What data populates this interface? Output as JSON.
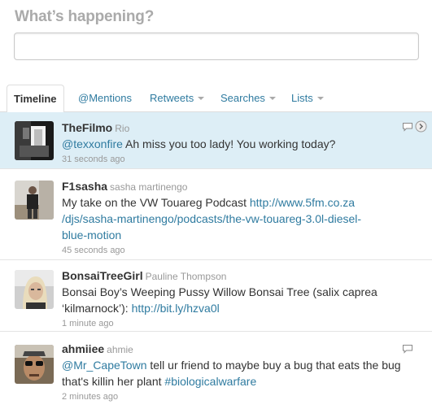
{
  "compose": {
    "title": "What’s happening?",
    "input_value": ""
  },
  "tabs": [
    {
      "label": "Timeline",
      "active": true
    },
    {
      "label": "@Mentions",
      "active": false
    },
    {
      "label": "Retweets",
      "active": false,
      "has_menu": true
    },
    {
      "label": "Searches",
      "active": false,
      "has_menu": true
    },
    {
      "label": "Lists",
      "active": false,
      "has_menu": true
    }
  ],
  "tweets": [
    {
      "screen_name": "TheFilmo",
      "full_name": "Rio",
      "mention": "@texxonfire",
      "text": " Ah miss you too lady! You working today?",
      "time": "31 seconds ago",
      "highlighted": true
    },
    {
      "screen_name": "F1sasha",
      "full_name": "sasha martinengo",
      "text_before": "My take on the VW Touareg Podcast ",
      "link": "http://www.5fm.co.za/djs/sasha-martinengo/podcasts/the-vw-touareg-3.0l-diesel-blue-motion",
      "link_line1": "http://www.5fm.co.za",
      "link_line2": "/djs/sasha-martinengo/podcasts/the-vw-touareg-3.0l-diesel-",
      "link_line3": "blue-motion",
      "time": "45 seconds ago"
    },
    {
      "screen_name": "BonsaiTreeGirl",
      "full_name": "Pauline Thompson",
      "text_line1": "Bonsai Boy’s Weeping Pussy Willow Bonsai Tree (salix caprea",
      "text_line2": "‘kilmarnock’): ",
      "link": "http://bit.ly/hzva0l",
      "time": "1 minute ago"
    },
    {
      "screen_name": "ahmiiee",
      "full_name": "ahmie",
      "mention": "@Mr_CapeTown",
      "text_line1": " tell ur friend to maybe buy a bug that eats the bug",
      "text_line2": "that's killin her plant ",
      "hashtag": "#biologicalwarfare",
      "time": "2 minutes ago"
    }
  ],
  "icons": {
    "reply": "reply-icon",
    "more": "arrow-right-circle-icon"
  },
  "colors": {
    "link": "#2f7ba0",
    "highlight_bg": "#ddeef6",
    "muted": "#999999"
  }
}
